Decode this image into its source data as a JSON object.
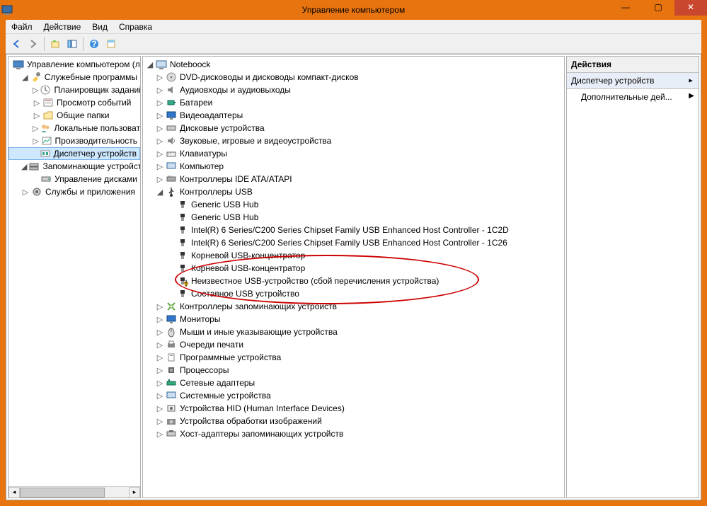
{
  "window": {
    "title": "Управление компьютером"
  },
  "menu": {
    "file": "Файл",
    "action": "Действие",
    "view": "Вид",
    "help": "Справка"
  },
  "left_tree": {
    "root": "Управление компьютером (л",
    "svc_tools": "Служебные программы",
    "scheduler": "Планировщик заданий",
    "eventvwr": "Просмотр событий",
    "shared": "Общие папки",
    "local_users": "Локальные пользовате",
    "perf": "Производительность",
    "devmgr": "Диспетчер устройств",
    "storage": "Запоминающие устройст",
    "diskmgr": "Управление дисками",
    "services": "Службы и приложения"
  },
  "mid_tree": {
    "root": "Noteboock",
    "dvd": "DVD-дисководы и дисководы компакт-дисков",
    "audio": "Аудиовходы и аудиовыходы",
    "battery": "Батареи",
    "video": "Видеоадаптеры",
    "disk": "Дисковые устройства",
    "sound": "Звуковые, игровые и видеоустройства",
    "kbd": "Клавиатуры",
    "computer": "Компьютер",
    "ide": "Контроллеры IDE ATA/ATAPI",
    "usb": "Контроллеры USB",
    "usb_children": {
      "hub1": "Generic USB Hub",
      "hub2": "Generic USB Hub",
      "intel1": "Intel(R) 6 Series/C200 Series Chipset Family USB Enhanced Host Controller - 1C2D",
      "intel2": "Intel(R) 6 Series/C200 Series Chipset Family USB Enhanced Host Controller - 1C26",
      "roothub1": "Корневой USB-концентратор",
      "roothub2": "Корневой USB-концентратор",
      "unknown": "Неизвестное USB-устройство (сбой перечисления устройства)",
      "composite": "Составное USB устройство"
    },
    "storage_ctrl": "Контроллеры запоминающих устройств",
    "monitors": "Мониторы",
    "mice": "Мыши и иные указывающие устройства",
    "printq": "Очереди печати",
    "software": "Программные устройства",
    "cpu": "Процессоры",
    "net": "Сетевые адаптеры",
    "system": "Системные устройства",
    "hid": "Устройства HID (Human Interface Devices)",
    "imaging": "Устройства обработки изображений",
    "hostadap": "Хост-адаптеры запоминающих устройств"
  },
  "actions": {
    "header": "Действия",
    "section": "Диспетчер устройств",
    "more": "Дополнительные дей..."
  }
}
